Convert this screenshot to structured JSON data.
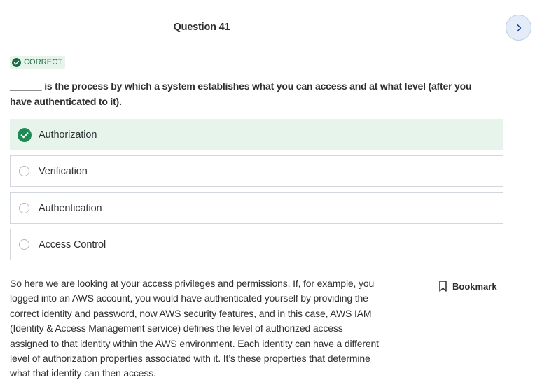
{
  "header": {
    "question_title": "Question 41"
  },
  "navigation": {
    "next_icon": "chevron-right-icon"
  },
  "status": {
    "label": "CORRECT",
    "color": "#1e6b43",
    "icon": "check-circle-icon"
  },
  "question": {
    "text": "______ is the process by which a system establishes what you can access and at what level (after you have authenticated to it)."
  },
  "options": [
    {
      "label": "Authorization",
      "selected": true,
      "correct": true
    },
    {
      "label": "Verification",
      "selected": false
    },
    {
      "label": "Authentication",
      "selected": false
    },
    {
      "label": "Access Control",
      "selected": false
    }
  ],
  "explanation": {
    "text": "So here we are looking at your access privileges and permissions. If, for example, you logged into an AWS account, you would have authenticated yourself by providing the correct identity and password, now AWS security features, and in this case, AWS IAM (Identity & Access Management service) defines the level of authorized access assigned to that identity within the AWS environment. Each identity can have a different level of authorization properties associated with it. It’s these properties that determine what that identity can then access."
  },
  "bookmark": {
    "label": "Bookmark",
    "icon": "bookmark-icon"
  },
  "colors": {
    "correct_green": "#1e8b52",
    "selected_bg": "#e6f4ec",
    "accent_blue": "#1c3f94"
  }
}
